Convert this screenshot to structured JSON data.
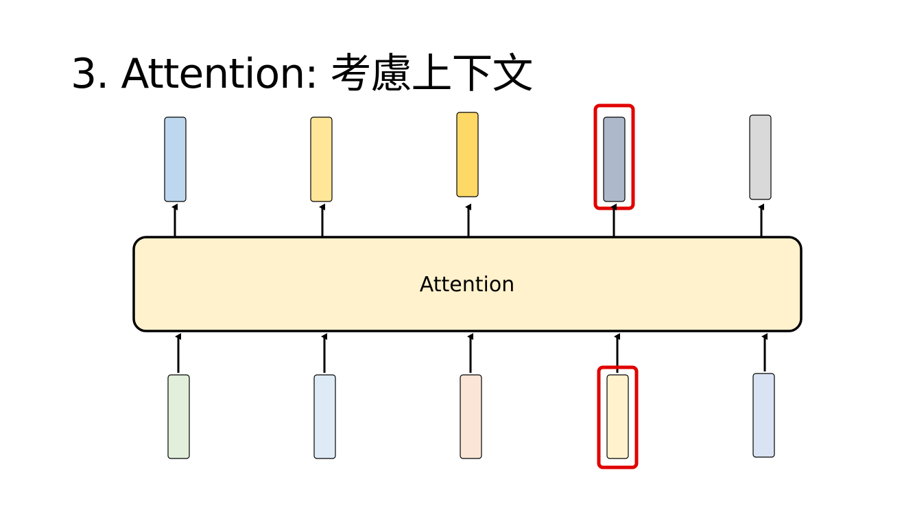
{
  "title": "3. Attention: 考慮上下文",
  "attention_block": {
    "label": "Attention",
    "fill": "#FFF2CC",
    "stroke": "#000000"
  },
  "highlight_color": "#E00000",
  "outputs": [
    {
      "name": "output-vector-1",
      "color": "#BDD7EE",
      "highlighted": false
    },
    {
      "name": "output-vector-2",
      "color": "#FFE699",
      "highlighted": false
    },
    {
      "name": "output-vector-3",
      "color": "#FFD966",
      "highlighted": false
    },
    {
      "name": "output-vector-4",
      "color": "#ADB9CA",
      "highlighted": true
    },
    {
      "name": "output-vector-5",
      "color": "#D9D9D9",
      "highlighted": false
    }
  ],
  "inputs": [
    {
      "name": "input-vector-1",
      "color": "#E2EFDA",
      "highlighted": false
    },
    {
      "name": "input-vector-2",
      "color": "#DEEBF7",
      "highlighted": false
    },
    {
      "name": "input-vector-3",
      "color": "#FBE5D6",
      "highlighted": false
    },
    {
      "name": "input-vector-4",
      "color": "#FFF2CC",
      "highlighted": true
    },
    {
      "name": "input-vector-5",
      "color": "#DAE3F3",
      "highlighted": false
    }
  ]
}
